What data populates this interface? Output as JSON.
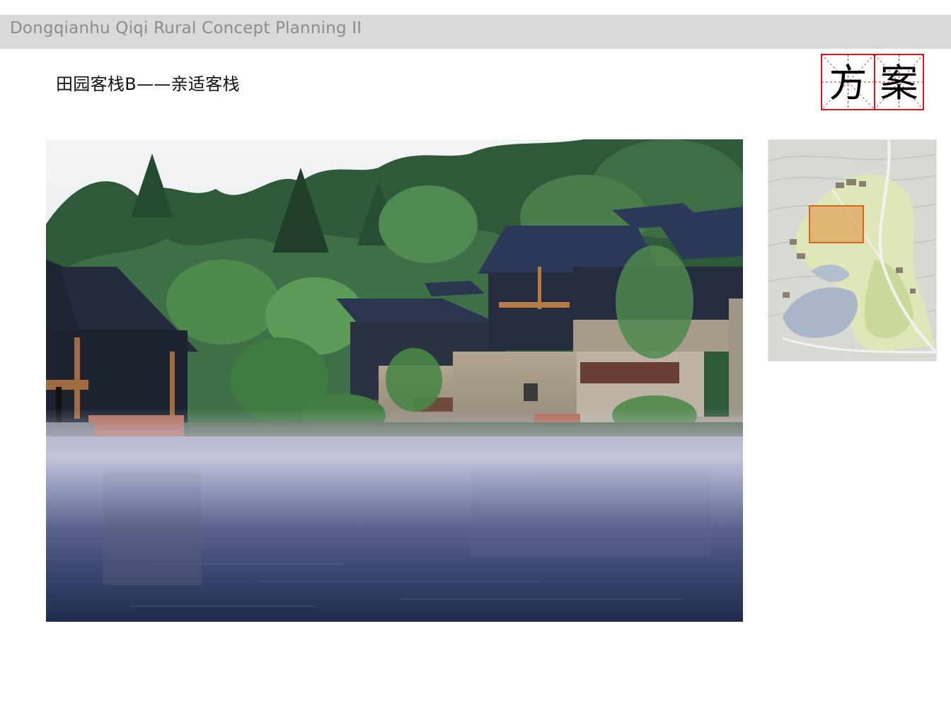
{
  "header": {
    "title": "Dongqianhu Qiqi Rural Concept Planning II"
  },
  "slide": {
    "title": "田园客栈B——亲适客栈"
  },
  "stamp": {
    "characters": [
      "方",
      "案"
    ],
    "color": "#d4181f"
  },
  "photo": {
    "subject": "misty-lake-guesthouse"
  },
  "site_map": {
    "highlight_color": "#e08a3a"
  }
}
